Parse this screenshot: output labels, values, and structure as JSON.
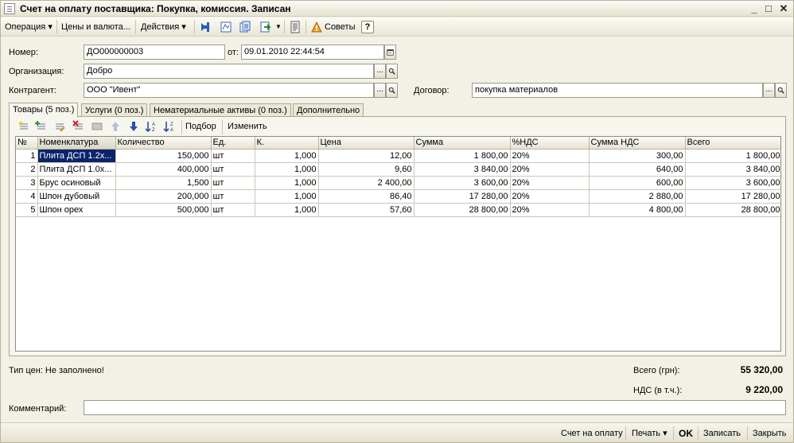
{
  "window": {
    "title": "Счет на оплату поставщика: Покупка, комиссия. Записан",
    "minimize": "_",
    "maximize": "□",
    "close": "✕"
  },
  "toolbar": {
    "operation": "Операция ▾",
    "prices": "Цены и валюта...",
    "actions": "Действия ▾",
    "tips": "Советы",
    "help": "?"
  },
  "form": {
    "number_label": "Номер:",
    "number_value": "ДО000000003",
    "date_label": "от:",
    "date_value": "09.01.2010 22:44:54",
    "org_label": "Организация:",
    "org_value": "Добро",
    "contractor_label": "Контрагент:",
    "contractor_value": "ООО \"Ивент\"",
    "contract_label": "Договор:",
    "contract_value": "покупка материалов",
    "ellipsis": "...",
    "search": "🔍"
  },
  "tabs": [
    {
      "label": "Товары (5 поз.)"
    },
    {
      "label": "Услуги (0 поз.)"
    },
    {
      "label": "Нематериальные активы (0 поз.)"
    },
    {
      "label": "Дополнительно"
    }
  ],
  "grid_toolbar": {
    "pick": "Подбор",
    "change": "Изменить"
  },
  "table": {
    "columns": [
      "№",
      "Номенклатура",
      "Количество",
      "Ед.",
      "К.",
      "Цена",
      "Сумма",
      "%НДС",
      "Сумма НДС",
      "Всего"
    ],
    "rows": [
      [
        "1",
        "Плита ДСП 1.2х...",
        "150,000",
        "шт",
        "1,000",
        "12,00",
        "1 800,00",
        "20%",
        "300,00",
        "1 800,00"
      ],
      [
        "2",
        "Плита ДСП 1.0х...",
        "400,000",
        "шт",
        "1,000",
        "9,60",
        "3 840,00",
        "20%",
        "640,00",
        "3 840,00"
      ],
      [
        "3",
        "Брус осиновый",
        "1,500",
        "шт",
        "1,000",
        "2 400,00",
        "3 600,00",
        "20%",
        "600,00",
        "3 600,00"
      ],
      [
        "4",
        "Шпон дубовый",
        "200,000",
        "шт",
        "1,000",
        "86,40",
        "17 280,00",
        "20%",
        "2 880,00",
        "17 280,00"
      ],
      [
        "5",
        "Шпон орех",
        "500,000",
        "шт",
        "1,000",
        "57,60",
        "28 800,00",
        "20%",
        "4 800,00",
        "28 800,00"
      ]
    ]
  },
  "summary": {
    "price_type": "Тип цен: Не заполнено!",
    "total_label": "Всего (грн):",
    "total_value": "55 320,00",
    "vat_label": "НДС (в т.ч.):",
    "vat_value": "9 220,00"
  },
  "comment": {
    "label": "Комментарий:",
    "value": ""
  },
  "footer": {
    "invoice": "Счет на оплату",
    "print": "Печать ▾",
    "ok": "OK",
    "save": "Записать",
    "close": "Закрыть"
  }
}
